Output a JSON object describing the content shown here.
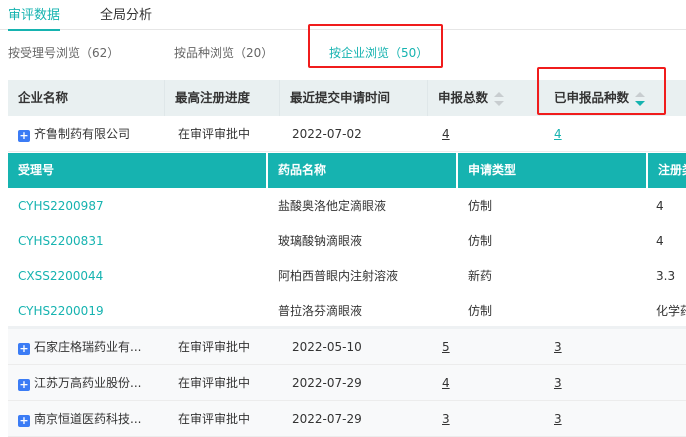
{
  "tabs": [
    "审评数据",
    "全局分析"
  ],
  "subnav": [
    "按受理号浏览（62）",
    "按品种浏览（20）",
    "按企业浏览（50）"
  ],
  "columns": [
    "企业名称",
    "最高注册进度",
    "最近提交申请时间",
    "申报总数",
    "已申报品种数"
  ],
  "rows": [
    {
      "company": "齐鲁制药有限公司",
      "progress": "在审评审批中",
      "date": "2022-07-02",
      "total": "4",
      "varieties": "4"
    },
    {
      "company": "石家庄格瑞药业有...",
      "progress": "在审评审批中",
      "date": "2022-05-10",
      "total": "5",
      "varieties": "3"
    },
    {
      "company": "江苏万高药业股份...",
      "progress": "在审评审批中",
      "date": "2022-07-29",
      "total": "4",
      "varieties": "3"
    },
    {
      "company": "南京恒道医药科技...",
      "progress": "在审评审批中",
      "date": "2022-07-29",
      "total": "3",
      "varieties": "3"
    }
  ],
  "nested": {
    "columns": [
      "受理号",
      "药品名称",
      "申请类型",
      "注册类"
    ],
    "rows": [
      {
        "id": "CYHS2200987",
        "drug": "盐酸奥洛他定滴眼液",
        "type": "仿制",
        "reg": "4"
      },
      {
        "id": "CYHS2200831",
        "drug": "玻璃酸钠滴眼液",
        "type": "仿制",
        "reg": "4"
      },
      {
        "id": "CXSS2200044",
        "drug": "阿柏西普眼内注射溶液",
        "type": "新药",
        "reg": "3.3"
      },
      {
        "id": "CYHS2200019",
        "drug": "普拉洛芬滴眼液",
        "type": "仿制",
        "reg": "化学药"
      }
    ]
  },
  "colors": {
    "accent": "#16b3b0",
    "highlight": "#f01c1c",
    "expand": "#3b7cf5"
  }
}
